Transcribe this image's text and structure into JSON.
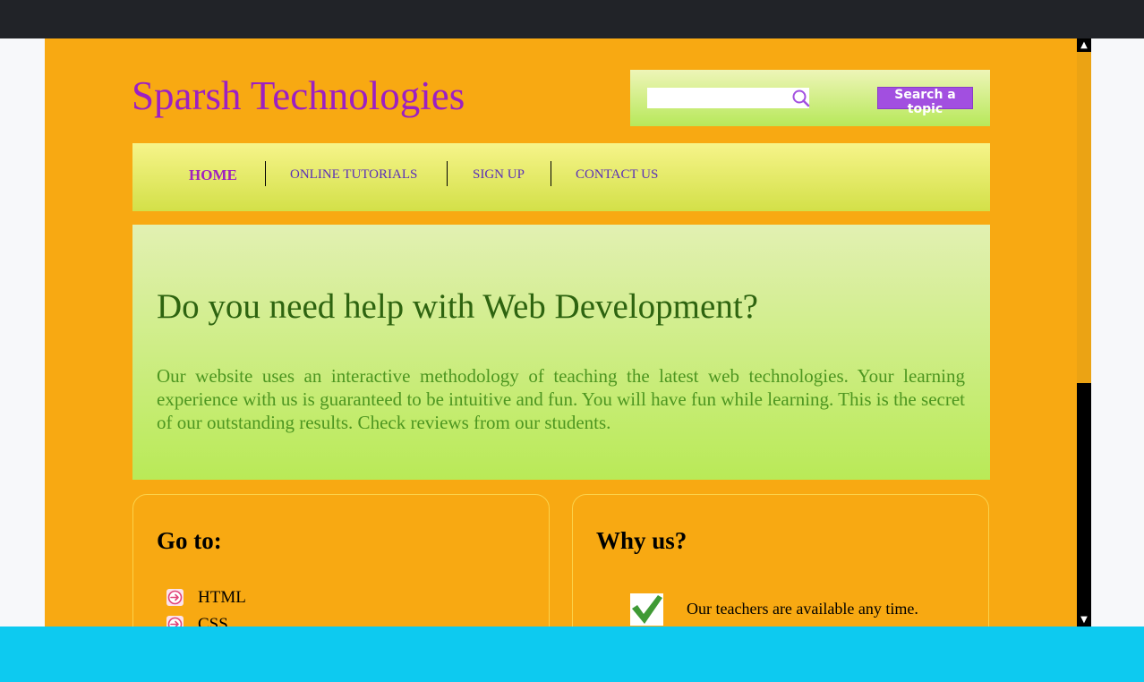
{
  "site": {
    "title": "Sparsh Technologies"
  },
  "search": {
    "placeholder": "",
    "value": "",
    "button_label": "Search a topic"
  },
  "nav": {
    "items": [
      {
        "label": "HOME"
      },
      {
        "label": "ONLINE TUTORIALS"
      },
      {
        "label": "SIGN UP"
      },
      {
        "label": "CONTACT US"
      }
    ]
  },
  "hero": {
    "title": "Do you need help with Web Development?",
    "text": "Our website uses an interactive methodology of teaching the latest web technologies. Your learning experience with us is guaranteed to be intuitive and fun. You will have fun while learning. This is the secret of our outstanding results. Check reviews from our students."
  },
  "goto": {
    "title": "Go to:",
    "items": [
      {
        "label": "HTML"
      },
      {
        "label": "CSS"
      }
    ]
  },
  "why": {
    "title": "Why us?",
    "items": [
      {
        "text": "Our teachers are available any time."
      }
    ]
  },
  "colors": {
    "page_bg": "#f8a912",
    "title": "#9d1fc3",
    "hero_title": "#2e6410",
    "hero_text": "#4d9620",
    "search_button": "#a24fe0",
    "nav_link": "#5a2fb8",
    "bottom_bar": "#0dcaf0",
    "top_bar": "#212328"
  },
  "icons": {
    "search": "search-icon",
    "list_arrow": "arrow-circle-right-icon",
    "check": "checkmark-icon",
    "scroll_up": "chevron-up-icon",
    "scroll_down": "chevron-down-icon"
  }
}
